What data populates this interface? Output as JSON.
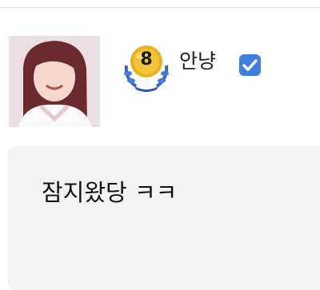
{
  "post": {
    "author": {
      "name": "안냥",
      "level": "8",
      "verified_icon": "verified-check-icon",
      "level_badge_icon": "laurel-level-badge-icon",
      "avatar": "profile-photo"
    },
    "comment": {
      "text": "잠지왔당 ㅋㅋ"
    }
  },
  "colors": {
    "verified": "#3d7fe0",
    "badge_gold": "#e8b21f",
    "badge_laurel": "#3a63c9",
    "comment_bg": "#f3f3f3"
  }
}
